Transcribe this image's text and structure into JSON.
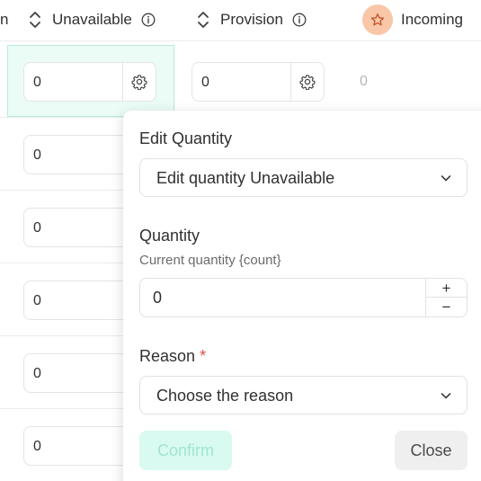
{
  "header": {
    "col_prev_fragment": "n",
    "col_unavailable": "Unavailable",
    "col_provision": "Provision",
    "col_incoming": "Incoming"
  },
  "table": {
    "rows": [
      {
        "unavailable": "0",
        "provision": "0",
        "incoming": "0"
      },
      {
        "unavailable": "0"
      },
      {
        "unavailable": "0"
      },
      {
        "unavailable": "0"
      },
      {
        "unavailable": "0"
      },
      {
        "unavailable": "0"
      }
    ]
  },
  "popover": {
    "title": "Edit Quantity",
    "mode_select_value": "Edit quantity Unavailable",
    "quantity_label": "Quantity",
    "quantity_hint": "Current quantity {count}",
    "quantity_value": "0",
    "plus": "+",
    "minus": "−",
    "reason_label": "Reason",
    "reason_required": "*",
    "reason_placeholder": "Choose the reason",
    "confirm_label": "Confirm",
    "close_label": "Close"
  },
  "colors": {
    "accent_highlight": "#ebfcf6",
    "confirm_bg": "#d8faf0",
    "incoming_badge": "#f9c7a8",
    "required": "#e24c4c"
  },
  "icons": [
    "sort-icon",
    "info-icon",
    "star-icon",
    "gear-icon",
    "chevron-down-icon"
  ]
}
